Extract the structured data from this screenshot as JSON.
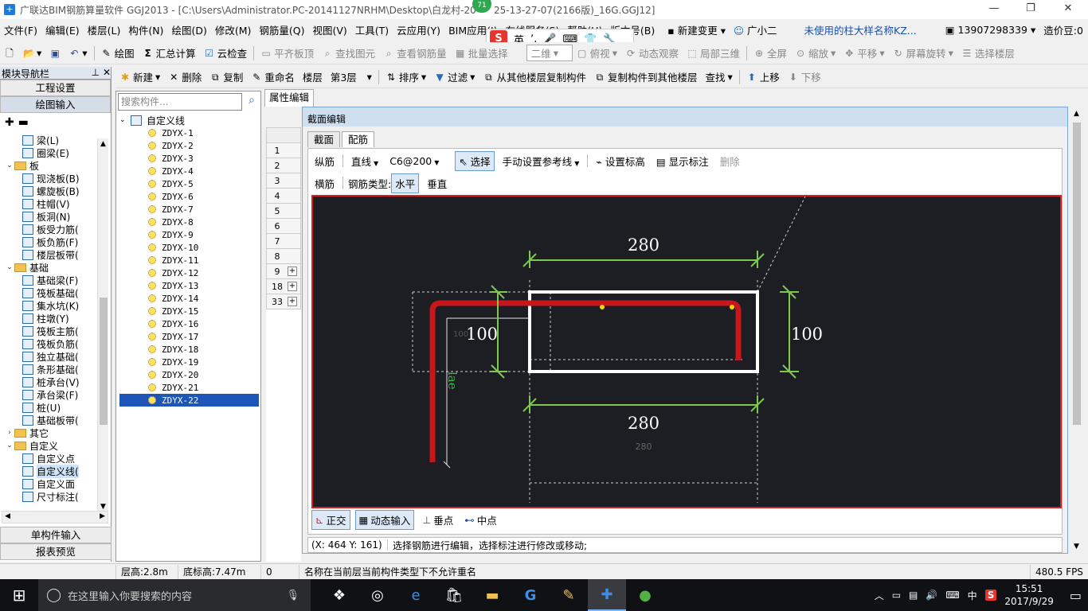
{
  "window": {
    "title": "广联达BIM钢筋算量软件 GGJ2013 - [C:\\Users\\Administrator.PC-20141127NRHM\\Desktop\\白龙村-20",
    "title_tail": "25-13-27-07(2166版)_16G.GGJ12]",
    "badge": "71"
  },
  "menu": [
    "文件(F)",
    "编辑(E)",
    "楼层(L)",
    "构件(N)",
    "绘图(D)",
    "修改(M)",
    "钢筋量(Q)",
    "视图(V)",
    "工具(T)",
    "云应用(Y)",
    "BIM应用(I)",
    "在线服务(S)",
    "帮助(H)",
    "版本号(B)"
  ],
  "menu_right": {
    "new_change": "新建变更",
    "assistant": "广小二",
    "notice": "未使用的柱大样名称KZ...",
    "phone": "13907298339",
    "price_bean": "造价豆:0"
  },
  "ime": {
    "lang": "英"
  },
  "toolbar1": {
    "draw": "绘图",
    "sum": "汇总计算",
    "cloud_check": "云检查",
    "flat_top": "平齐板顶",
    "find_elem": "查找图元",
    "view_rebar": "查看钢筋量",
    "batch_select": "批量选择",
    "view_mode": "二维",
    "top_view": "俯视",
    "dynamic": "动态观察",
    "local_3d": "局部三维",
    "full": "全屏",
    "zoom": "缩放",
    "pan": "平移",
    "rotate": "屏幕旋转",
    "select_floor": "选择楼层"
  },
  "toolbar2": {
    "new": "新建",
    "delete": "删除",
    "copy": "复制",
    "rename": "重命名",
    "floor_label": "楼层",
    "floor": "第3层",
    "sort": "排序",
    "filter": "过滤",
    "copy_from": "从其他楼层复制构件",
    "copy_to": "复制构件到其他楼层",
    "find": "查找",
    "up": "上移",
    "down": "下移"
  },
  "nav": {
    "header": "模块导航栏",
    "project_settings": "工程设置",
    "draw_input": "绘图输入",
    "items": [
      {
        "label": "梁(L)",
        "level": 2
      },
      {
        "label": "圈梁(E)",
        "level": 2
      },
      {
        "label": "板",
        "level": 1,
        "folder": true
      },
      {
        "label": "现浇板(B)",
        "level": 2
      },
      {
        "label": "螺旋板(B)",
        "level": 2
      },
      {
        "label": "柱帽(V)",
        "level": 2
      },
      {
        "label": "板洞(N)",
        "level": 2
      },
      {
        "label": "板受力筋(",
        "level": 2
      },
      {
        "label": "板负筋(F)",
        "level": 2
      },
      {
        "label": "楼层板带(",
        "level": 2
      },
      {
        "label": "基础",
        "level": 1,
        "folder": true
      },
      {
        "label": "基础梁(F)",
        "level": 2
      },
      {
        "label": "筏板基础(",
        "level": 2
      },
      {
        "label": "集水坑(K)",
        "level": 2
      },
      {
        "label": "柱墩(Y)",
        "level": 2
      },
      {
        "label": "筏板主筋(",
        "level": 2
      },
      {
        "label": "筏板负筋(",
        "level": 2
      },
      {
        "label": "独立基础(",
        "level": 2
      },
      {
        "label": "条形基础(",
        "level": 2
      },
      {
        "label": "桩承台(V)",
        "level": 2
      },
      {
        "label": "承台梁(F)",
        "level": 2
      },
      {
        "label": "桩(U)",
        "level": 2
      },
      {
        "label": "基础板带(",
        "level": 2
      },
      {
        "label": "其它",
        "level": 1,
        "folder": true,
        "collapsed": true
      },
      {
        "label": "自定义",
        "level": 1,
        "folder": true
      },
      {
        "label": "自定义点",
        "level": 2
      },
      {
        "label": "自定义线(",
        "level": 2,
        "selected": true
      },
      {
        "label": "自定义面",
        "level": 2
      },
      {
        "label": "尺寸标注(",
        "level": 2
      }
    ],
    "single_input": "单构件输入",
    "report": "报表预览"
  },
  "components": {
    "search_placeholder": "搜索构件...",
    "root": "自定义线",
    "items": [
      "ZDYX-1",
      "ZDYX-2",
      "ZDYX-3",
      "ZDYX-4",
      "ZDYX-5",
      "ZDYX-6",
      "ZDYX-7",
      "ZDYX-8",
      "ZDYX-9",
      "ZDYX-10",
      "ZDYX-11",
      "ZDYX-12",
      "ZDYX-13",
      "ZDYX-14",
      "ZDYX-15",
      "ZDYX-16",
      "ZDYX-17",
      "ZDYX-18",
      "ZDYX-19",
      "ZDYX-20",
      "ZDYX-21",
      "ZDYX-22"
    ],
    "selected": "ZDYX-22"
  },
  "props": {
    "tab": "属性编辑",
    "rows": [
      "1",
      "2",
      "3",
      "4",
      "5",
      "6",
      "7",
      "8",
      "9",
      "18",
      "33"
    ]
  },
  "dialog": {
    "title": "截面编辑",
    "tabs": [
      "截面",
      "配筋"
    ],
    "active_tab": "配筋",
    "row1": {
      "longitudinal": "纵筋",
      "line": "直线",
      "spec": "C6@200",
      "select": "选择",
      "ref_line": "手动设置参考线",
      "set_mark": "设置标高",
      "show_mark": "显示标注",
      "delete": "删除"
    },
    "row2": {
      "horizontal_bar": "横筋",
      "type_label": "钢筋类型:",
      "horizontal": "水平",
      "vertical": "垂直"
    },
    "bottom": {
      "ortho": "正交",
      "dynamic_input": "动态输入",
      "perpendicular": "垂点",
      "midpoint": "中点"
    },
    "status": {
      "coords": "(X: 464 Y: 161)",
      "msg": "选择钢筋进行编辑，选择标注进行修改或移动;"
    }
  },
  "drawing": {
    "dim_top": "280",
    "dim_bottom": "280",
    "dim_bottom_small": "280",
    "dim_left": "100",
    "dim_right": "100",
    "dim_small_left": "100",
    "lae": "lae",
    "colors": {
      "bg": "#1d1e24",
      "rebar": "#c8161d",
      "dim": "#7ec850",
      "section": "#ffffff",
      "point": "#f5d400"
    }
  },
  "statusbar": {
    "floor_height": "层高:2.8m",
    "base_height": "底标高:7.47m",
    "zero": "0",
    "message": "名称在当前层当前构件类型下不允许重名",
    "fps": "480.5 FPS"
  },
  "taskbar": {
    "search_placeholder": "在这里输入你要搜索的内容",
    "ime_lang": "中",
    "time": "15:51",
    "date": "2017/9/29"
  }
}
